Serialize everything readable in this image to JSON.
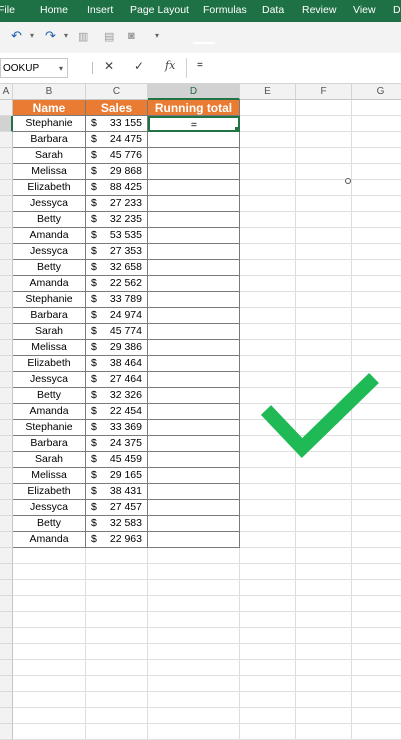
{
  "ribbon": {
    "tabs": [
      "File",
      "Home",
      "Insert",
      "Page Layout",
      "Formulas",
      "Data",
      "Review",
      "View",
      "D"
    ]
  },
  "quick_access": {
    "icons": [
      "undo-icon",
      "redo-icon",
      "format-painter-icon",
      "camera-icon",
      "customize-dropdown-icon"
    ]
  },
  "formula_bar": {
    "name_box": "OOKUP",
    "cancel": "✕",
    "enter": "✓",
    "fx": "fx",
    "content": "="
  },
  "columns": [
    "A",
    "B",
    "C",
    "D",
    "E",
    "F",
    "G"
  ],
  "table": {
    "headers": [
      "Name",
      "Sales",
      "Running total"
    ],
    "currency": "$",
    "rows": [
      {
        "name": "Stephanie",
        "sales": "33 155"
      },
      {
        "name": "Barbara",
        "sales": "24 475"
      },
      {
        "name": "Sarah",
        "sales": "45 776"
      },
      {
        "name": "Melissa",
        "sales": "29 868"
      },
      {
        "name": "Elizabeth",
        "sales": "88 425"
      },
      {
        "name": "Jessyca",
        "sales": "27 233"
      },
      {
        "name": "Betty",
        "sales": "32 235"
      },
      {
        "name": "Amanda",
        "sales": "53 535"
      },
      {
        "name": "Jessyca",
        "sales": "27 353"
      },
      {
        "name": "Betty",
        "sales": "32 658"
      },
      {
        "name": "Amanda",
        "sales": "22 562"
      },
      {
        "name": "Stephanie",
        "sales": "33 789"
      },
      {
        "name": "Barbara",
        "sales": "24 974"
      },
      {
        "name": "Sarah",
        "sales": "45 774"
      },
      {
        "name": "Melissa",
        "sales": "29 386"
      },
      {
        "name": "Elizabeth",
        "sales": "38 464"
      },
      {
        "name": "Jessyca",
        "sales": "27 464"
      },
      {
        "name": "Betty",
        "sales": "32 326"
      },
      {
        "name": "Amanda",
        "sales": "22 454"
      },
      {
        "name": "Stephanie",
        "sales": "33 369"
      },
      {
        "name": "Barbara",
        "sales": "24 375"
      },
      {
        "name": "Sarah",
        "sales": "45 459"
      },
      {
        "name": "Melissa",
        "sales": "29 165"
      },
      {
        "name": "Elizabeth",
        "sales": "38 431"
      },
      {
        "name": "Jessyca",
        "sales": "27 457"
      },
      {
        "name": "Betty",
        "sales": "32 583"
      },
      {
        "name": "Amanda",
        "sales": "22 963"
      }
    ],
    "active_cell_value": "="
  },
  "colors": {
    "ribbon": "#1e7145",
    "header_fill": "#e97c32",
    "checkmark": "#1fb955",
    "selection": "#217346"
  },
  "overlay": {
    "icon": "checkmark-icon"
  }
}
